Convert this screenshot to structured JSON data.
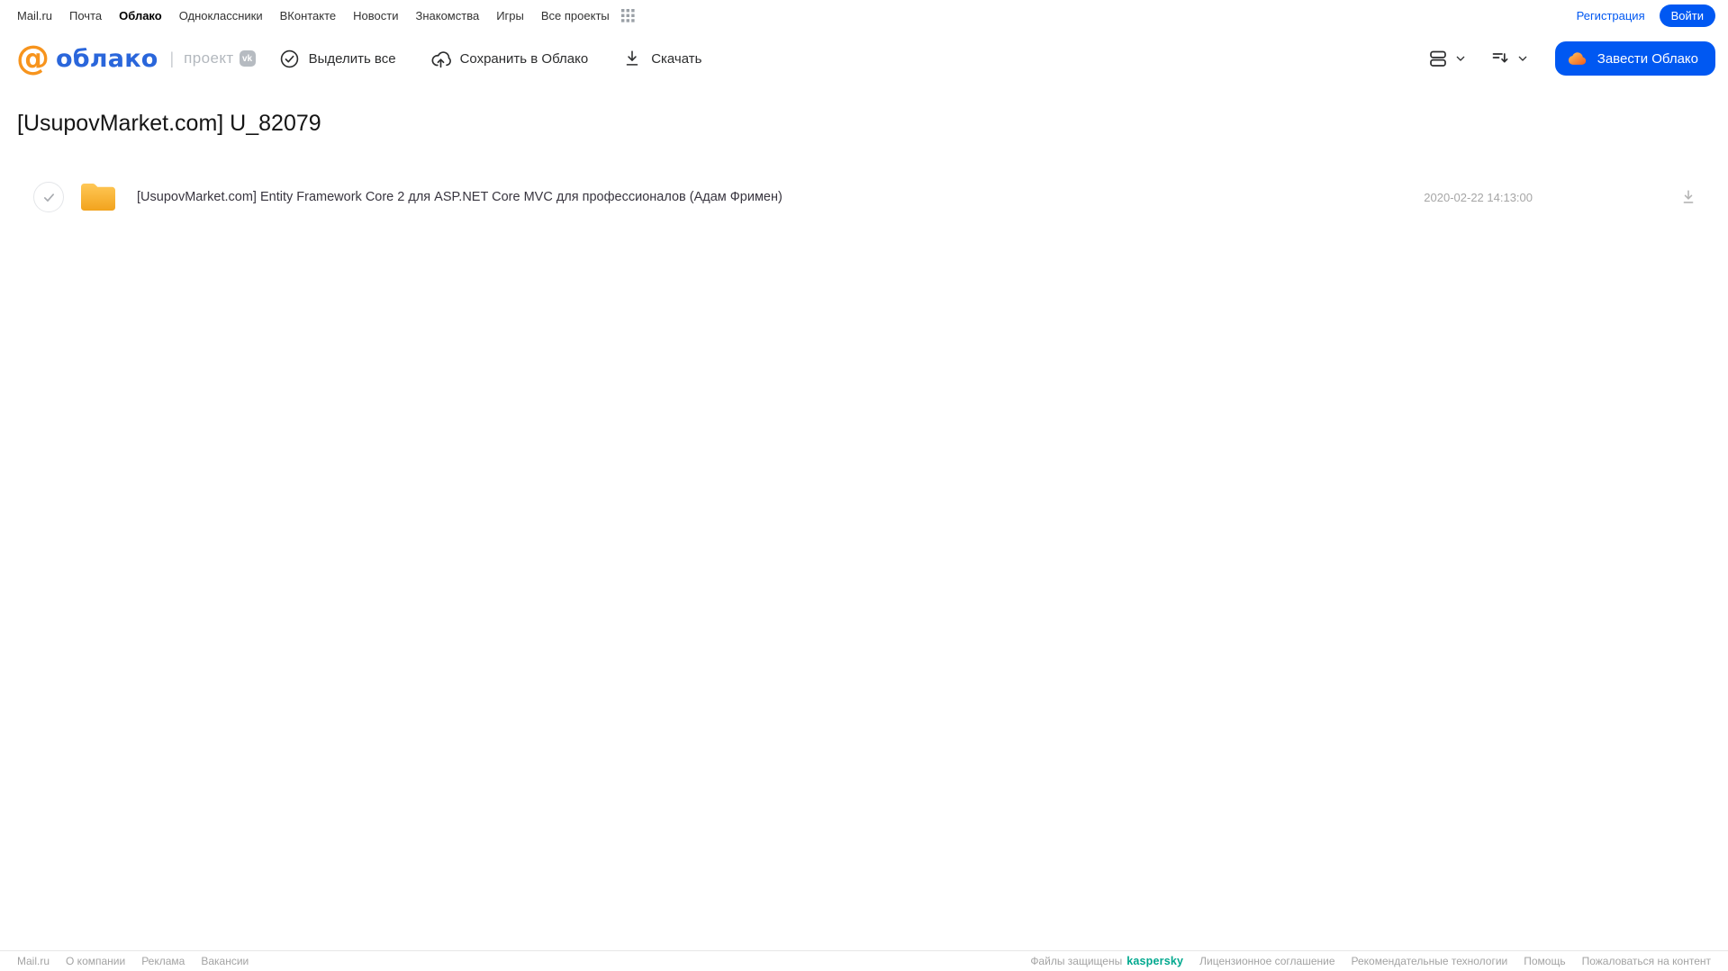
{
  "topnav": {
    "links": [
      "Mail.ru",
      "Почта",
      "Облако",
      "Одноклассники",
      "ВКонтакте",
      "Новости",
      "Знакомства",
      "Игры",
      "Все проекты"
    ],
    "active_link": "Облако",
    "registration": "Регистрация",
    "login": "Войти"
  },
  "header": {
    "logo_at": "@",
    "logo_text": "облако",
    "divider": "|",
    "project_label": "проект",
    "vk_badge": "vk",
    "actions": [
      {
        "label": "Выделить все",
        "icon": "check-circle-icon"
      },
      {
        "label": "Сохранить в Облако",
        "icon": "cloud-upload-icon"
      },
      {
        "label": "Скачать",
        "icon": "download-icon"
      }
    ],
    "view_icon": "view-mode-icon",
    "sort_icon": "sort-icon",
    "get_cloud_button": "Завести Облако"
  },
  "page": {
    "title": "[UsupovMarket.com] U_82079"
  },
  "files": [
    {
      "type": "folder",
      "name": "[UsupovMarket.com] Entity Framework Core 2 для ASP.NET Core MVC для профессионалов (Адам Фримен)",
      "date": "2020-02-22 14:13:00"
    }
  ],
  "footer": {
    "left_links": [
      "Mail.ru",
      "О компании",
      "Реклама",
      "Вакансии"
    ],
    "protected_text": "Файлы защищены",
    "protected_brand": "kaspersky",
    "right_links": [
      "Лицензионное соглашение",
      "Рекомендательные технологии",
      "Помощь",
      "Пожаловаться на контент"
    ]
  },
  "colors": {
    "accent_blue": "#0058f2",
    "logo_orange": "#f7941d",
    "logo_blue": "#2a66db",
    "folder_top": "#ffc857",
    "folder_bottom": "#f2a31d",
    "kaspersky_teal": "#00a88e",
    "muted_gray": "#a3a3a3"
  }
}
